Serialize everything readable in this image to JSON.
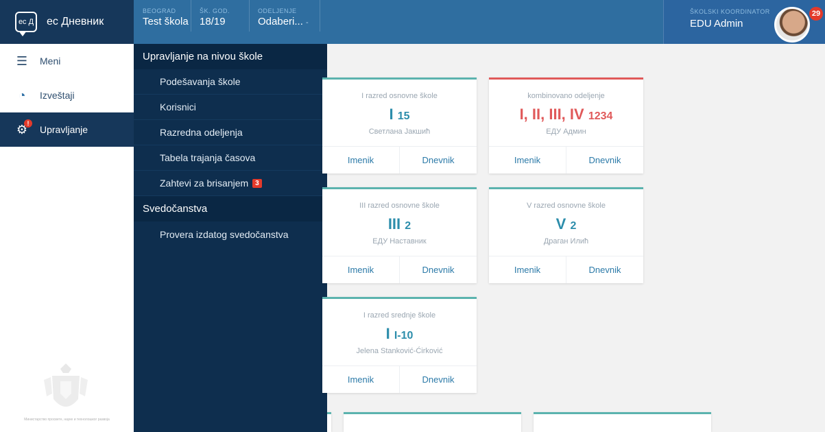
{
  "brand": {
    "logo_text": "ec Д",
    "name": "ec Дневник"
  },
  "topbar": {
    "cells": [
      {
        "label": "BEOGRAD",
        "value": "Test škola",
        "caret": ""
      },
      {
        "label": "ŠK. GOD.",
        "value": "18/19",
        "caret": ""
      },
      {
        "label": "ODELJENJE",
        "value": "Odaberi...",
        "caret": "-"
      }
    ],
    "user": {
      "role": "ŠKOLSKI KOORDINATOR",
      "name": "EDU Admin",
      "notifications": "29"
    }
  },
  "sidebar": {
    "items": [
      {
        "label": "Meni",
        "icon": "hamburger-icon",
        "glyph": "☰"
      },
      {
        "label": "Izveštaji",
        "icon": "pie-chart-icon",
        "glyph": "◔"
      },
      {
        "label": "Upravljanje",
        "icon": "gear-icon",
        "glyph": "⚙",
        "badge": "!"
      }
    ],
    "ministry": "Министарство просвете, науке и технолошког развоја"
  },
  "menu": {
    "sections": [
      {
        "title": "Upravljanje na nivou škole",
        "items": [
          {
            "label": "Podešavanja škole"
          },
          {
            "label": "Korisnici"
          },
          {
            "label": "Razredna odeljenja"
          },
          {
            "label": "Tabela trajanja časova"
          },
          {
            "label": "Zahtevi za brisanjem",
            "badge": "3"
          }
        ]
      },
      {
        "title": "Svedočanstva",
        "items": [
          {
            "label": "Provera izdatog svedočanstva"
          }
        ]
      }
    ]
  },
  "colors": {
    "accent": "#5bb3ae",
    "combined": "#e0595a",
    "link": "#2c7aa8",
    "navy": "#16375a"
  },
  "cards": [
    {
      "type": "I razred osnovne škole",
      "grade": "I",
      "section": "15",
      "teacher": "Светлана Јакшић",
      "link1": "Imenik",
      "link2": "Dnevnik"
    },
    {
      "type": "kombinovano odeljenje",
      "grade": "I, II, III, IV",
      "section": "1234",
      "teacher": "ЕДУ Админ",
      "link1": "Imenik",
      "link2": "Dnevnik"
    },
    {
      "type": "III razred osnovne škole",
      "grade": "III",
      "section": "2",
      "teacher": "ЕДУ Наставник",
      "link1": "Imenik",
      "link2": "Dnevnik"
    },
    {
      "type": "V razred osnovne škole",
      "grade": "V",
      "section": "2",
      "teacher": "Драган Илић",
      "link1": "Imenik",
      "link2": "Dnevnik"
    },
    {
      "type": "I razred srednje škole",
      "grade": "I",
      "section": "I-10",
      "teacher": "Jelena Stanković-Ćirković",
      "link1": "Imenik",
      "link2": "Dnevnik"
    }
  ]
}
